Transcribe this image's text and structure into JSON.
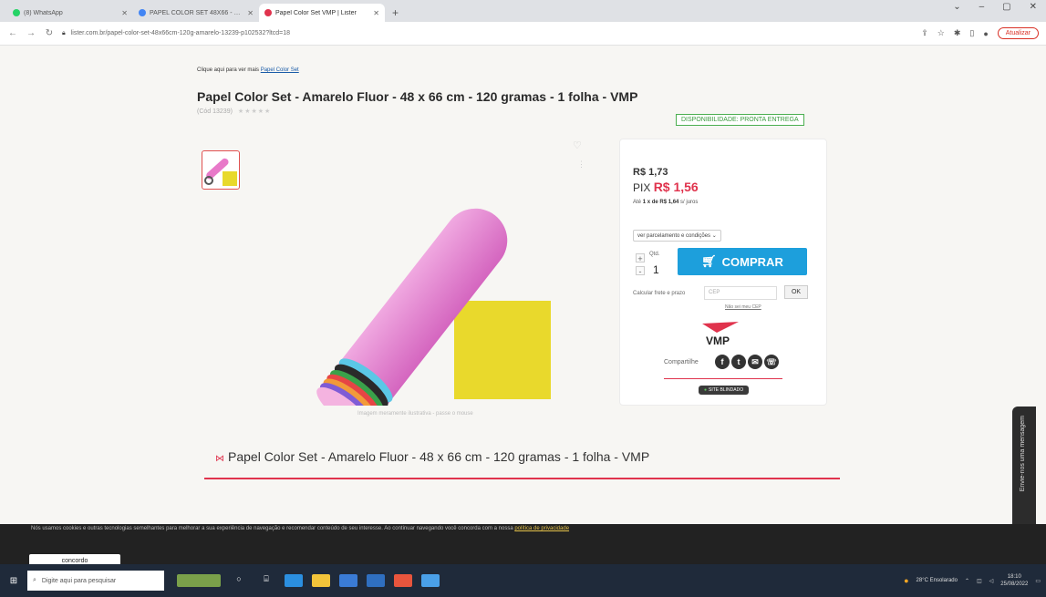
{
  "browser": {
    "tabs": [
      {
        "title": "(8) WhatsApp",
        "favicon_color": "#25d366",
        "active": false
      },
      {
        "title": "PAPEL COLOR SET 48X66 - Googl",
        "favicon_color": "#4285f4",
        "active": false
      },
      {
        "title": "Papel Color Set VMP | Lister",
        "favicon_color": "#e0334d",
        "active": true
      }
    ],
    "new_tab": "+",
    "url": "lister.com.br/papel-color-set-48x66cm-120g-amarelo-13239-p102532?ltcd=18",
    "update_label": "Atualizar",
    "window_controls": [
      "⌄",
      "–",
      "▢",
      "✕"
    ]
  },
  "page": {
    "breadcrumb_prefix": "Clique aqui para ver mais ",
    "breadcrumb_link": "Papel Color Set",
    "title": "Papel Color Set - Amarelo Fluor - 48 x 66 cm - 120 gramas - 1 folha - VMP",
    "code": "(Cód 13239)",
    "stars": "★★★★★",
    "availability": "DISPONIBILIDADE: PRONTA ENTREGA",
    "image_caption": "Imagem meramente ilustrativa - passe o mouse",
    "price": "R$ 1,73",
    "pix_label": "PIX ",
    "pix_price": "R$ 1,56",
    "installment_prefix": "Até ",
    "installment_value": "1 x de R$ 1,64",
    "installment_suffix": " s/ juros",
    "installment_select": "ver parcelamento e condições ⌄",
    "qty_label": "Qtd.",
    "qty_value": "1",
    "qty_plus": "+",
    "qty_minus": "-",
    "buy_label": "COMPRAR",
    "shipping_label": "Calcular frete e prazo",
    "cep_placeholder": "CEP",
    "ok_label": "OK",
    "no_cep": "Não sei meu CEP",
    "brand": "VMP",
    "share_label": "Compartilhe",
    "secure_label": "SITE BLINDADO",
    "section_title": "Papel Color Set - Amarelo Fluor - 48 x 66 cm - 120 gramas - 1 folha - VMP",
    "accent": "#e0334d",
    "buy_color": "#1d9fdc"
  },
  "cookie": {
    "text": "Nós usamos cookies e outras tecnologias semelhantes para melhorar a sua experiência de navegação e recomendar conteúdo de seu interesse. Ao continuar navegando você concorda com a nossa ",
    "link": "política de privacidade",
    "button": "concordo"
  },
  "feedback_tab": "Envie-nos uma mensagem",
  "taskbar": {
    "search_placeholder": "Digite aqui para pesquisar",
    "weather": "28°C  Ensolarado",
    "time": "18:10",
    "date": "25/08/2022"
  }
}
